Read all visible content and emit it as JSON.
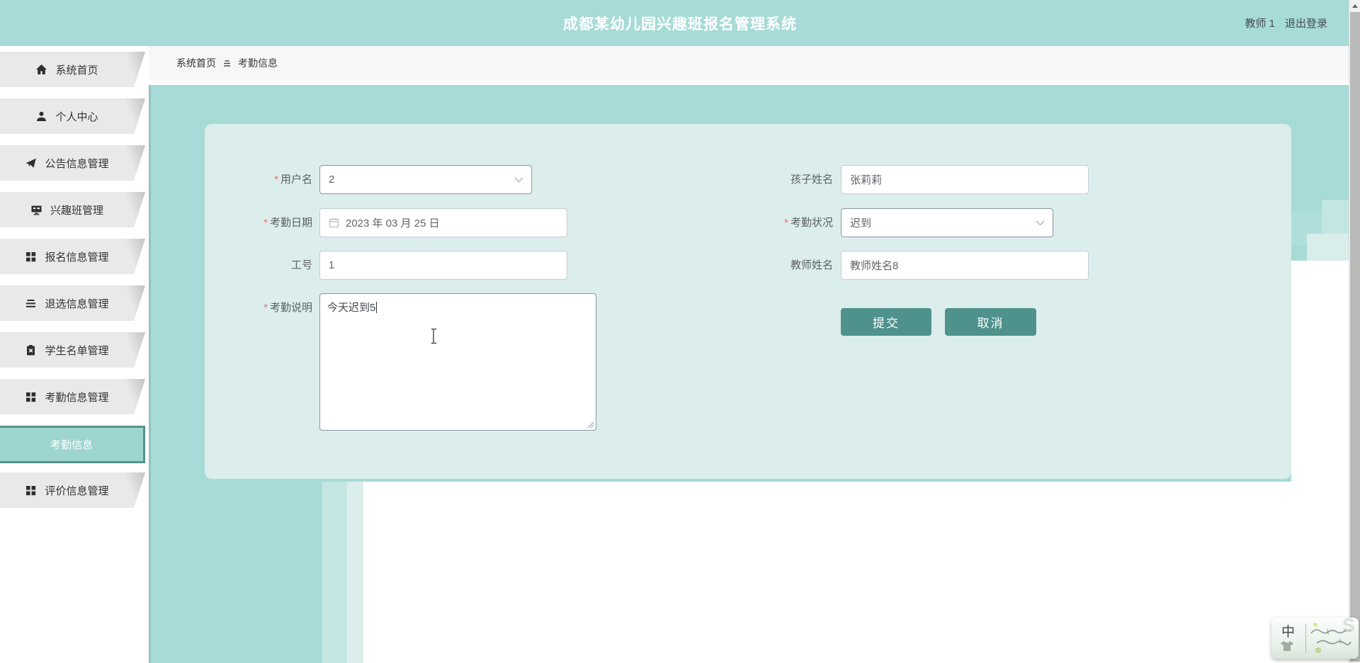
{
  "header": {
    "title": "成都某幼儿园兴趣班报名管理系统",
    "username": "教师 1",
    "logout_label": "退出登录"
  },
  "sidebar": {
    "items": [
      {
        "label": "系统首页",
        "icon": "home-icon"
      },
      {
        "label": "个人中心",
        "icon": "user-icon"
      },
      {
        "label": "公告信息管理",
        "icon": "send-icon"
      },
      {
        "label": "兴趣班管理",
        "icon": "desktop-icon"
      },
      {
        "label": "报名信息管理",
        "icon": "grid-icon"
      },
      {
        "label": "退选信息管理",
        "icon": "list-icon"
      },
      {
        "label": "学生名单管理",
        "icon": "clipboard-x-icon"
      },
      {
        "label": "考勤信息管理",
        "icon": "grid-icon"
      },
      {
        "label": "评价信息管理",
        "icon": "grid-icon"
      }
    ],
    "active_item": "考勤信息"
  },
  "breadcrumb": {
    "root": "系统首页",
    "current": "考勤信息"
  },
  "form": {
    "required_mark": "*",
    "username": {
      "label": "用户名",
      "value": "2"
    },
    "child_name": {
      "label": "孩子姓名",
      "value": "张莉莉"
    },
    "attendance_date": {
      "label": "考勤日期",
      "value": "2023 年 03 月 25 日"
    },
    "attendance_status": {
      "label": "考勤状况",
      "value": "迟到"
    },
    "work_no": {
      "label": "工号",
      "value": "1"
    },
    "teacher_name": {
      "label": "教师姓名",
      "value": "教师姓名8"
    },
    "note": {
      "label": "考勤说明",
      "value": "今天迟到5"
    },
    "submit_label": "提交",
    "cancel_label": "取消"
  },
  "ime": {
    "mode_char": "中"
  },
  "colors": {
    "header_teal": "#a7dbd7",
    "band_teal": "#a6dbd7",
    "panel_bg": "#dbeeec",
    "primary_button": "#4f928b",
    "active_menu_bg": "#9ed5d0",
    "active_menu_border": "#54928b",
    "required_mark": "#f56c6c",
    "menu_item_bg": "#e9e9e9"
  }
}
